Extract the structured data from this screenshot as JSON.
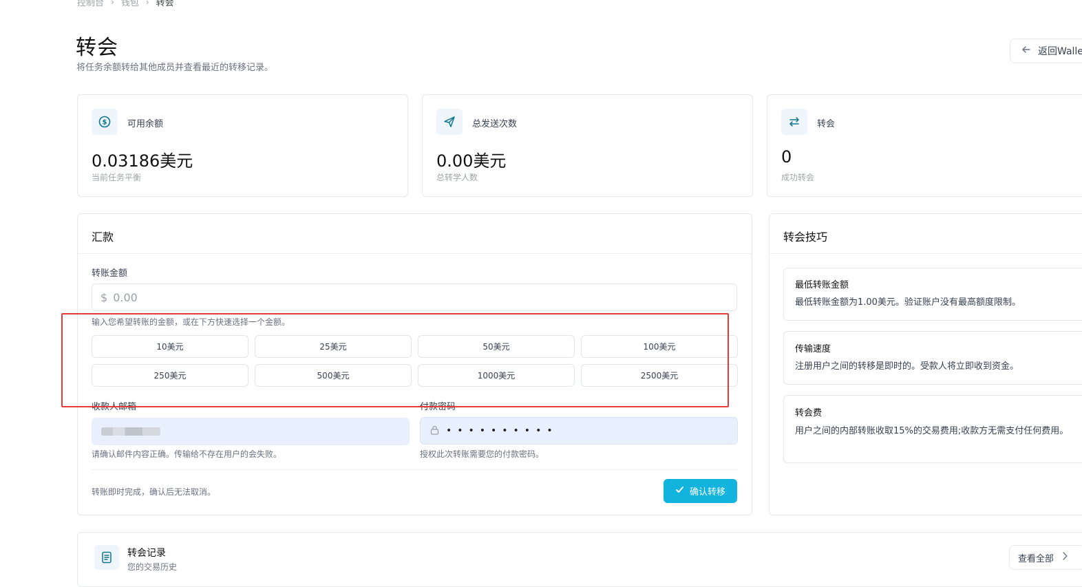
{
  "breadcrumb": {
    "items": [
      "控制台",
      "钱包",
      "转会"
    ]
  },
  "header": {
    "title": "转会",
    "subtitle": "将任务余额转给其他成员并查看最近的转移记录。",
    "back_label": "返回Wallet"
  },
  "stats": [
    {
      "icon": "dollar-circle-icon",
      "label": "可用余额",
      "value": "0.03186美元",
      "sub": "当前任务平衡"
    },
    {
      "icon": "paper-plane-icon",
      "label": "总发送次数",
      "value": "0.00美元",
      "sub": "总转学人数"
    },
    {
      "icon": "swap-arrows-icon",
      "label": "转会",
      "value": "0",
      "sub": "成功转会"
    }
  ],
  "remit": {
    "title": "汇款",
    "amount_label": "转账金额",
    "currency_symbol": "$",
    "amount_placeholder": "0.00",
    "amount_hint": "输入您希望转账的金额，或在下方快速选择一个金额。",
    "quick_amounts": [
      "10美元",
      "25美元",
      "50美元",
      "100美元",
      "250美元",
      "500美元",
      "1000美元",
      "2500美元"
    ],
    "email_label": "收款人邮箱",
    "email_hint": "请确认邮件内容正确。传输给不存在用户的会失败。",
    "password_label": "付款密码",
    "password_value": "••••••••••",
    "password_hint": "授权此次转账需要您的付款密码。",
    "footer_note": "转账即时完成，确认后无法取消。",
    "confirm_label": "确认转移"
  },
  "tips": {
    "title": "转会技巧",
    "items": [
      {
        "title": "最低转账金额",
        "text": "最低转账金额为1.00美元。验证账户没有最高额度限制。"
      },
      {
        "title": "传输速度",
        "text": "注册用户之间的转移是即时的。受款人将立即收到资金。"
      },
      {
        "title": "转会费",
        "text": "用户之间的内部转账收取15%的交易费用;收款方无需支付任何费用。"
      }
    ]
  },
  "history": {
    "title": "转会记录",
    "subtitle": "您的交易历史",
    "view_all_label": "查看全部"
  },
  "colors": {
    "accent": "#12b3dd",
    "highlight": "#e53935",
    "filled_input": "#e9f0fd"
  }
}
